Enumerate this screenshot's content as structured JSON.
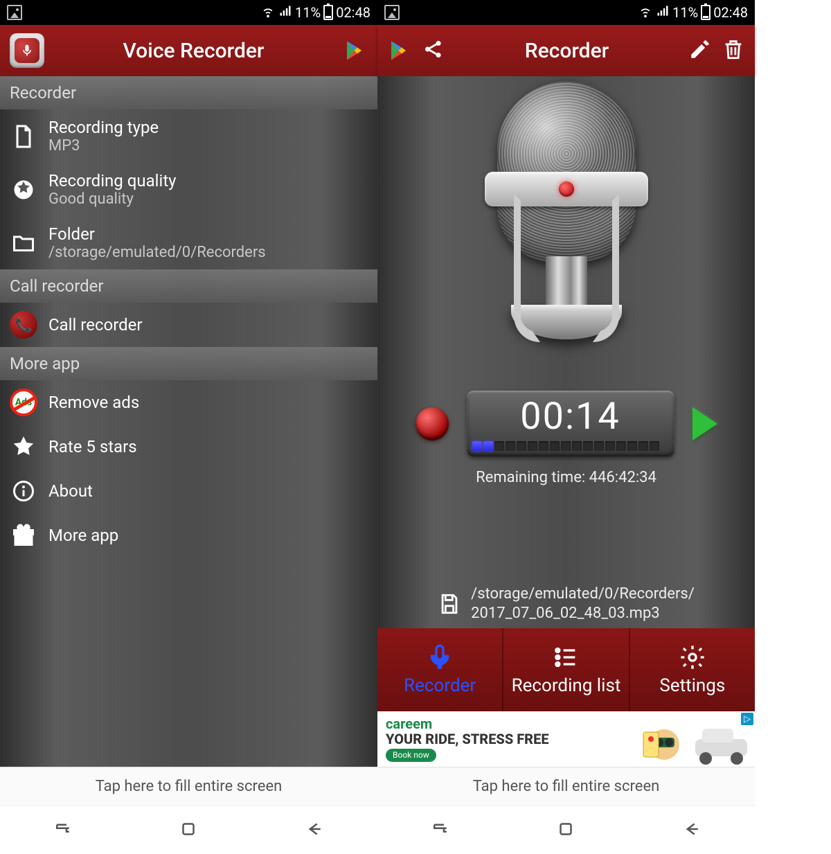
{
  "status": {
    "battery_pct": "11%",
    "time": "02:48"
  },
  "left_screen": {
    "title": "Voice Recorder",
    "section_recorder": "Recorder",
    "items_recorder": [
      {
        "title": "Recording type",
        "subtitle": "MP3"
      },
      {
        "title": "Recording quality",
        "subtitle": "Good quality"
      },
      {
        "title": "Folder",
        "subtitle": "/storage/emulated/0/Recorders"
      }
    ],
    "section_call": "Call recorder",
    "call_recorder_label": "Call recorder",
    "section_more": "More app",
    "remove_ads_label": "Remove ads",
    "remove_ads_badge": "Ads",
    "rate_label": "Rate 5 stars",
    "about_label": "About",
    "more_app_label": "More app",
    "fill_screen_hint": "Tap here to fill entire screen"
  },
  "right_screen": {
    "title": "Recorder",
    "timer": "00:14",
    "remaining_label": "Remaining time: 446:42:34",
    "save_path_line1": "/storage/emulated/0/Recorders/",
    "save_path_line2": "2017_07_06_02_48_03.mp3",
    "tabs": {
      "recorder": "Recorder",
      "recording_list": "Recording list",
      "settings": "Settings"
    },
    "ad": {
      "brand": "careem",
      "headline": "YOUR RIDE, STRESS FREE",
      "cta": "Book now"
    },
    "fill_screen_hint": "Tap here to fill entire screen"
  }
}
